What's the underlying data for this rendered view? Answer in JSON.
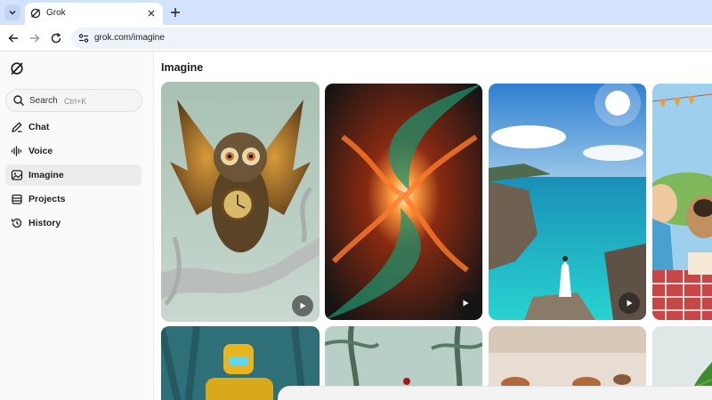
{
  "browser": {
    "tab": {
      "title": "Grok",
      "favicon": "grok-logo-icon"
    },
    "address_bar": {
      "url": "grok.com/imagine"
    },
    "icons": [
      "tab-search-icon",
      "close-icon",
      "plus-icon",
      "back-arrow-icon",
      "forward-arrow-icon",
      "reload-icon",
      "site-info-icon"
    ]
  },
  "sidebar": {
    "logo": "grok-logo-icon",
    "search": {
      "label": "Search",
      "shortcut": "Ctrl+K",
      "icon": "search-icon"
    },
    "items": [
      {
        "label": "Chat",
        "icon": "chat-icon",
        "active": false
      },
      {
        "label": "Voice",
        "icon": "waveform-icon",
        "active": false
      },
      {
        "label": "Imagine",
        "icon": "image-icon",
        "active": true
      },
      {
        "label": "Projects",
        "icon": "projects-icon",
        "active": false
      },
      {
        "label": "History",
        "icon": "history-icon",
        "active": false
      }
    ]
  },
  "main": {
    "title": "Imagine",
    "gallery": [
      {
        "subject": "steampunk owl with clock chest on silver branch",
        "video": true
      },
      {
        "subject": "fiery orange and green fractal swirl",
        "video": true
      },
      {
        "subject": "woman in white dress on rocky turquoise coast",
        "video": true
      },
      {
        "subject": "woman and pug with cake at garden party",
        "video": false
      },
      {
        "subject": "yellow robot in jungle",
        "video": false
      },
      {
        "subject": "misty palm forest",
        "video": false
      },
      {
        "subject": "kitchen with copper pots",
        "video": false
      },
      {
        "subject": "green leaves",
        "video": false
      }
    ]
  },
  "colors": {
    "tabstrip": "#d3e3fd",
    "sidebar_bg": "#fafafa",
    "active_item_bg": "#ececec",
    "text": "#1f1f1f"
  }
}
